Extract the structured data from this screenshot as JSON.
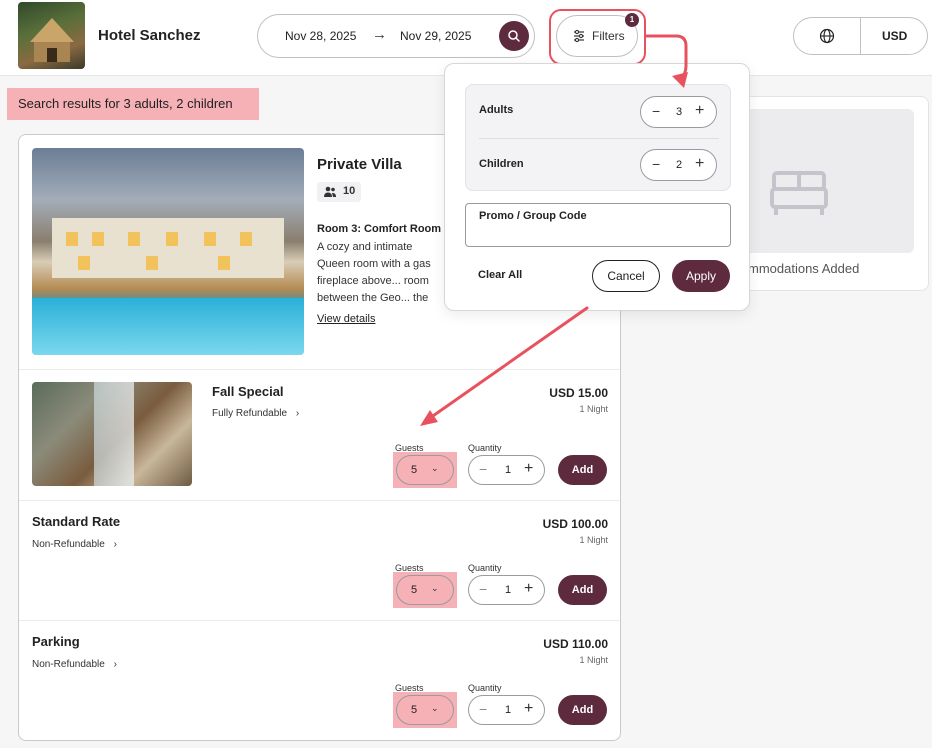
{
  "header": {
    "hotel_name": "Hotel Sanchez",
    "check_in": "Nov 28, 2025",
    "check_out": "Nov 29, 2025",
    "date_arrow": "→",
    "filters_label": "Filters",
    "filters_badge": "1",
    "currency": "USD"
  },
  "search_summary": "Search results for 3 adults, 2 children",
  "room": {
    "title": "Private Villa",
    "capacity": "10",
    "subtitle": "Room 3: Comfort Room",
    "description": "A cozy and intimate Queen room with a gas fireplace above... room between the Geo... the house is decorated...",
    "view_details": "View details"
  },
  "rates": [
    {
      "name": "Fall Special",
      "policy": "Fully Refundable",
      "chevron": "›",
      "price": "USD 15.00",
      "unit": "1 Night",
      "guests_label": "Guests",
      "guests_value": "5",
      "quantity_label": "Quantity",
      "quantity_value": "1",
      "add_label": "Add"
    },
    {
      "name": "Standard Rate",
      "policy": "Non-Refundable",
      "chevron": "›",
      "price": "USD 100.00",
      "unit": "1 Night",
      "guests_label": "Guests",
      "guests_value": "5",
      "quantity_label": "Quantity",
      "quantity_value": "1",
      "add_label": "Add"
    },
    {
      "name": "Parking",
      "policy": "Non-Refundable",
      "chevron": "›",
      "price": "USD 110.00",
      "unit": "1 Night",
      "guests_label": "Guests",
      "guests_value": "5",
      "quantity_label": "Quantity",
      "quantity_value": "1",
      "add_label": "Add"
    }
  ],
  "cart": {
    "empty_text": "mmodations Added"
  },
  "filters_popup": {
    "adults_label": "Adults",
    "adults_value": "3",
    "children_label": "Children",
    "children_value": "2",
    "promo_label": "Promo / Group Code",
    "promo_value": "",
    "clear_all": "Clear All",
    "cancel": "Cancel",
    "apply": "Apply"
  },
  "colors": {
    "brand": "#5e2a3d",
    "highlight": "#f5b1b6",
    "annotation": "#e8525f"
  },
  "icons": [
    "search-icon",
    "filter-sliders-icon",
    "globe-icon",
    "guests-icon",
    "bed-icon",
    "chevron-right-icon",
    "chevron-down-icon",
    "minus-icon",
    "plus-icon"
  ]
}
